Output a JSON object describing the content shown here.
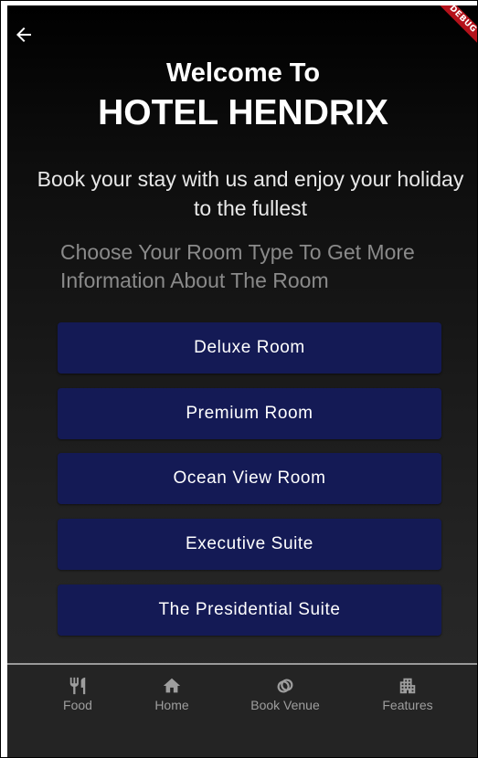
{
  "app": {
    "debug_banner": "DEBUG"
  },
  "header": {
    "welcome": "Welcome To",
    "hotel_name": "HOTEL HENDRIX",
    "tagline": "Book your stay with us and enjoy your holiday to the fullest",
    "prompt": "Choose Your Room Type To Get More Information About The Room"
  },
  "rooms": [
    {
      "label": "Deluxe Room"
    },
    {
      "label": "Premium Room"
    },
    {
      "label": "Ocean View Room"
    },
    {
      "label": "Executive Suite"
    },
    {
      "label": "The Presidential Suite"
    }
  ],
  "bottom_nav": {
    "items": [
      {
        "label": "Food",
        "icon": "restaurant-icon"
      },
      {
        "label": "Home",
        "icon": "home-icon"
      },
      {
        "label": "Book Venue",
        "icon": "rings-icon"
      },
      {
        "label": "Features",
        "icon": "apartment-icon"
      }
    ]
  },
  "colors": {
    "button_bg": "#141a55",
    "nav_bg": "#242424",
    "nav_text": "#9e9e9e",
    "prompt_text": "#8a8a8a",
    "debug_banner": "#b5121b"
  }
}
